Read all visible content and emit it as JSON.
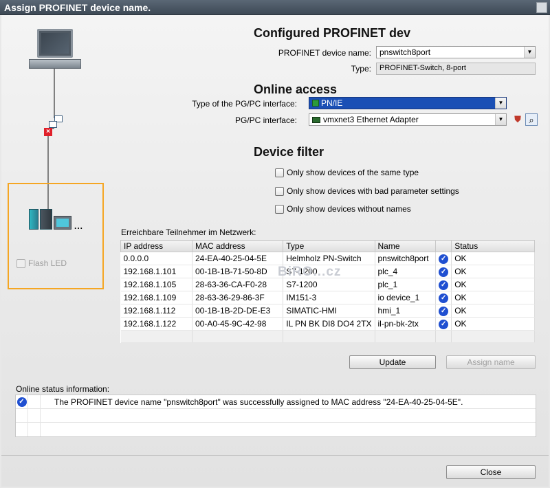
{
  "window": {
    "title": "Assign PROFINET device name."
  },
  "configured": {
    "heading": "Configured PROFINET dev",
    "device_name_label": "PROFINET device name:",
    "device_name_value": "pnswitch8port",
    "type_label": "Type:",
    "type_value": "PROFINET-Switch, 8-port"
  },
  "online": {
    "heading": "Online access",
    "interface_type_label": "Type of the PG/PC interface:",
    "interface_type_value": "PN/IE",
    "interface_label": "PG/PC interface:",
    "interface_value": "vmxnet3 Ethernet Adapter"
  },
  "filter": {
    "heading": "Device filter",
    "options": [
      "Only show devices of the same type",
      "Only show devices with bad parameter settings",
      "Only show devices without names"
    ]
  },
  "diagram": {
    "flash_led_label": "Flash LED",
    "dots": "..."
  },
  "grid": {
    "title": "Erreichbare Teilnehmer im Netzwerk:",
    "columns": [
      "IP address",
      "MAC address",
      "Type",
      "Name",
      "",
      "Status"
    ],
    "rows": [
      {
        "ip": "0.0.0.0",
        "mac": "24-EA-40-25-04-5E",
        "type": "Helmholz PN-Switch",
        "name": "pnswitch8port",
        "status": "OK"
      },
      {
        "ip": "192.168.1.101",
        "mac": "00-1B-1B-71-50-8D",
        "type": "S7-1200",
        "name": "plc_4",
        "status": "OK"
      },
      {
        "ip": "192.168.1.105",
        "mac": "28-63-36-CA-F0-28",
        "type": "S7-1200",
        "name": "plc_1",
        "status": "OK"
      },
      {
        "ip": "192.168.1.109",
        "mac": "28-63-36-29-86-3F",
        "type": "IM151-3",
        "name": "io device_1",
        "status": "OK"
      },
      {
        "ip": "192.168.1.112",
        "mac": "00-1B-1B-2D-DE-E3",
        "type": "SIMATIC-HMI",
        "name": "hmi_1",
        "status": "OK"
      },
      {
        "ip": "192.168.1.122",
        "mac": "00-A0-45-9C-42-98",
        "type": "IL PN BK DI8 DO4 2TX",
        "name": "il-pn-bk-2tx",
        "status": "OK"
      }
    ],
    "watermark": "BiRO...cz"
  },
  "buttons": {
    "update": "Update",
    "assign": "Assign name",
    "close": "Close"
  },
  "status": {
    "label": "Online status information:",
    "message": "The PROFINET device name \"pnswitch8port\" was successfully assigned to MAC address \"24-EA-40-25-04-5E\"."
  },
  "colors": {
    "highlight": "#1a4fb5",
    "frame": "#f5a623",
    "ok_icon": "#1f4fd1"
  },
  "icons": {
    "ok": "checkmark-circle-icon",
    "net": "network-icon",
    "adapter": "ethernet-adapter-icon",
    "shield": "shield-icon",
    "search": "search-icon"
  }
}
